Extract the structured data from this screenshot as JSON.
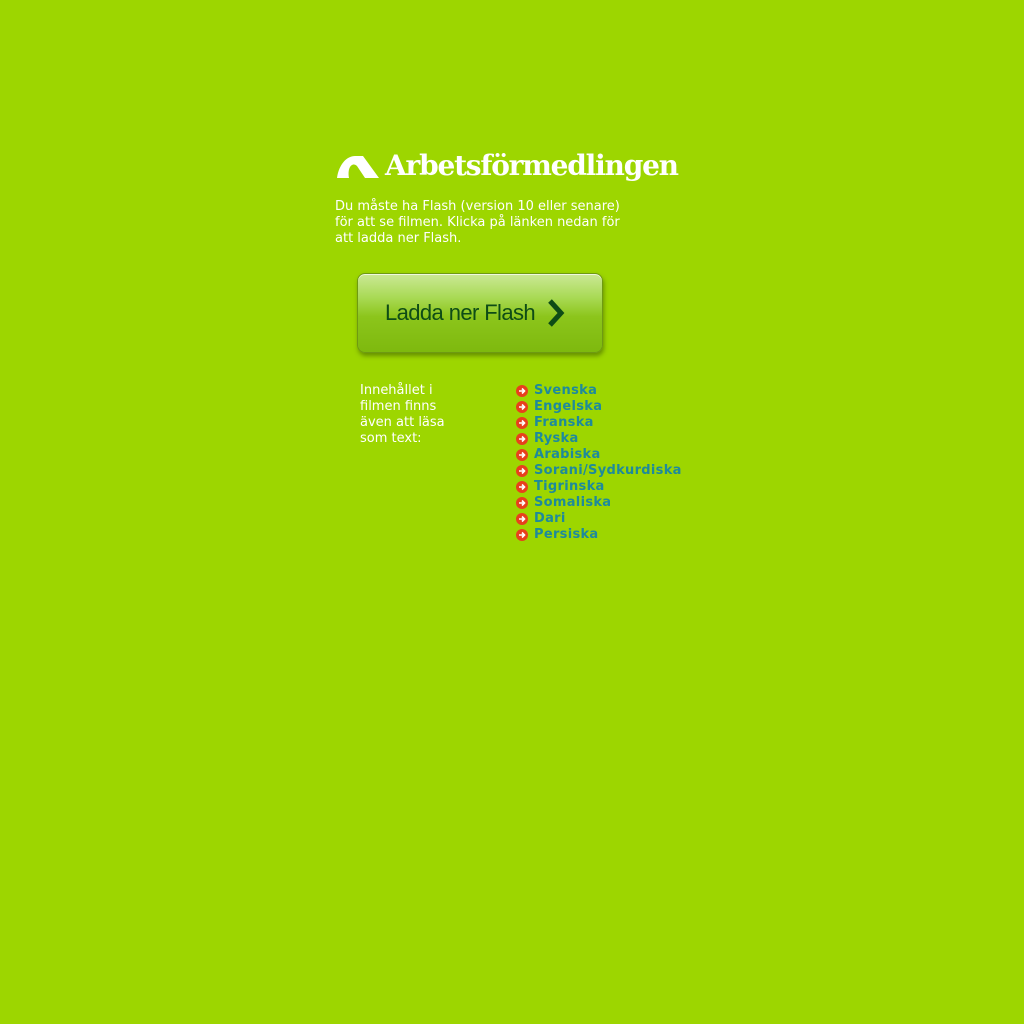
{
  "colors": {
    "background": "#9dd600",
    "text": "#ffffff",
    "link": "#1e8a9c",
    "bullet": "#e8401d",
    "button_text": "#0e4c16"
  },
  "logo": {
    "text": "Arbetsförmedlingen"
  },
  "intro": {
    "text": "Du måste ha Flash (version 10 eller senare) för att se filmen. Klicka på länken nedan för att ladda ner Flash."
  },
  "download_button": {
    "label": "Ladda ner Flash",
    "icon": "chevron-right-icon"
  },
  "side_note": {
    "text": "Innehållet i filmen finns även att läsa som text:"
  },
  "languages": [
    {
      "label": "Svenska"
    },
    {
      "label": "Engelska"
    },
    {
      "label": "Franska"
    },
    {
      "label": "Ryska"
    },
    {
      "label": "Arabiska"
    },
    {
      "label": "Sorani/Sydkurdiska"
    },
    {
      "label": "Tigrinska"
    },
    {
      "label": "Somaliska"
    },
    {
      "label": "Dari"
    },
    {
      "label": "Persiska"
    }
  ],
  "bullet_icon": "arrow-right-circle-icon"
}
